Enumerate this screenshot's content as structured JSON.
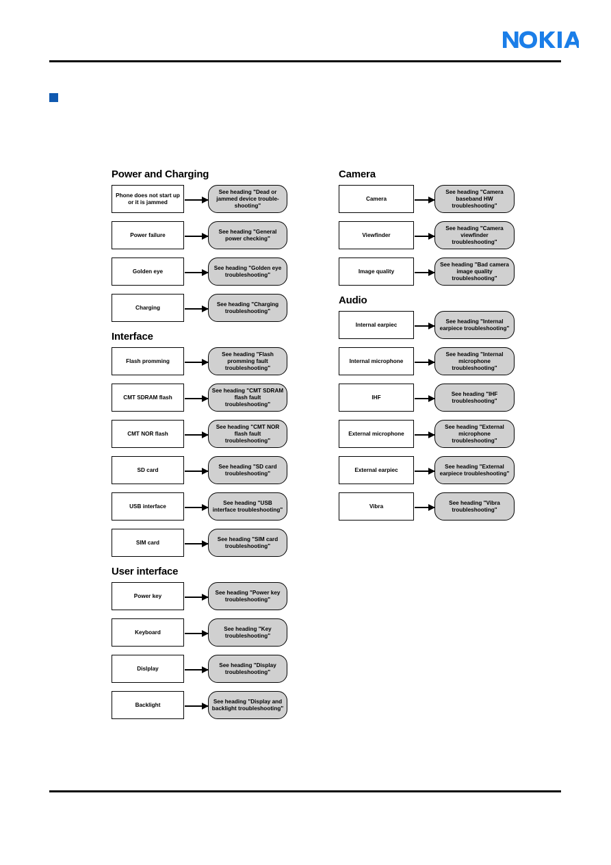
{
  "page": {
    "brand": "NOKIA",
    "brand_color": "#1B7EE8",
    "marker_color": "#1059b0"
  },
  "flowchart": {
    "type": "troubleshooting-flow",
    "columns": [
      {
        "name": "left",
        "groups": [
          {
            "title": "Power and Charging",
            "rows": [
              {
                "source": "Phone does not start up or it is jammed",
                "target": "See heading \"Dead or jammed device trouble-shooting\""
              },
              {
                "source": "Power failure",
                "target": "See heading \"General power checking\""
              },
              {
                "source": "Golden eye",
                "target": "See heading \"Golden eye troubleshooting\""
              },
              {
                "source": "Charging",
                "target": "See heading \"Charging troubleshooting\""
              }
            ]
          },
          {
            "title": "Interface",
            "rows": [
              {
                "source": "Flash promming",
                "target": "See heading \"Flash promming fault troubleshooting\""
              },
              {
                "source": "CMT SDRAM flash",
                "target": "See heading \"CMT SDRAM flash fault troubleshooting\""
              },
              {
                "source": "CMT NOR flash",
                "target": "See heading \"CMT NOR flash fault troubleshooting\""
              },
              {
                "source": "SD card",
                "target": "See heading \"SD card troubleshooting\""
              },
              {
                "source": "USB interface",
                "target": "See heading \"USB interface troubleshooting\""
              },
              {
                "source": "SIM card",
                "target": "See heading \"SIM card troubleshooting\""
              }
            ]
          },
          {
            "title": "User interface",
            "rows": [
              {
                "source": "Power key",
                "target": "See heading \"Power key troubleshooting\""
              },
              {
                "source": "Keyboard",
                "target": "See heading \"Key troubleshooting\""
              },
              {
                "source": "Dislplay",
                "target": "See heading \"Display troubleshooting\""
              },
              {
                "source": "Backlight",
                "target": "See heading \"Display and backlight troubleshooting\""
              }
            ]
          }
        ]
      },
      {
        "name": "right",
        "groups": [
          {
            "title": "Camera",
            "rows": [
              {
                "source": "Camera",
                "target": "See heading \"Camera baseband HW troubleshooting\""
              },
              {
                "source": "Viewfinder",
                "target": "See heading \"Camera viewfinder troubleshooting\""
              },
              {
                "source": "Image quality",
                "target": "See heading \"Bad camera image quality troubleshooting\""
              }
            ]
          },
          {
            "title": "Audio",
            "rows": [
              {
                "source": "Internal earpiec",
                "target": "See heading \"Internal earpiece troubleshooting\""
              },
              {
                "source": "Internal microphone",
                "target": "See heading \"Internal microphone troubleshooting\""
              },
              {
                "source": "IHF",
                "target": "See heading \"IHF troubleshooting\""
              },
              {
                "source": "External microphone",
                "target": "See heading \"External microphone troubleshooting\""
              },
              {
                "source": "External earpiec",
                "target": "See heading \"External earpiece troubleshooting\""
              },
              {
                "source": "Vibra",
                "target": "See heading \"Vibra troubleshooting\""
              }
            ]
          }
        ]
      }
    ]
  }
}
